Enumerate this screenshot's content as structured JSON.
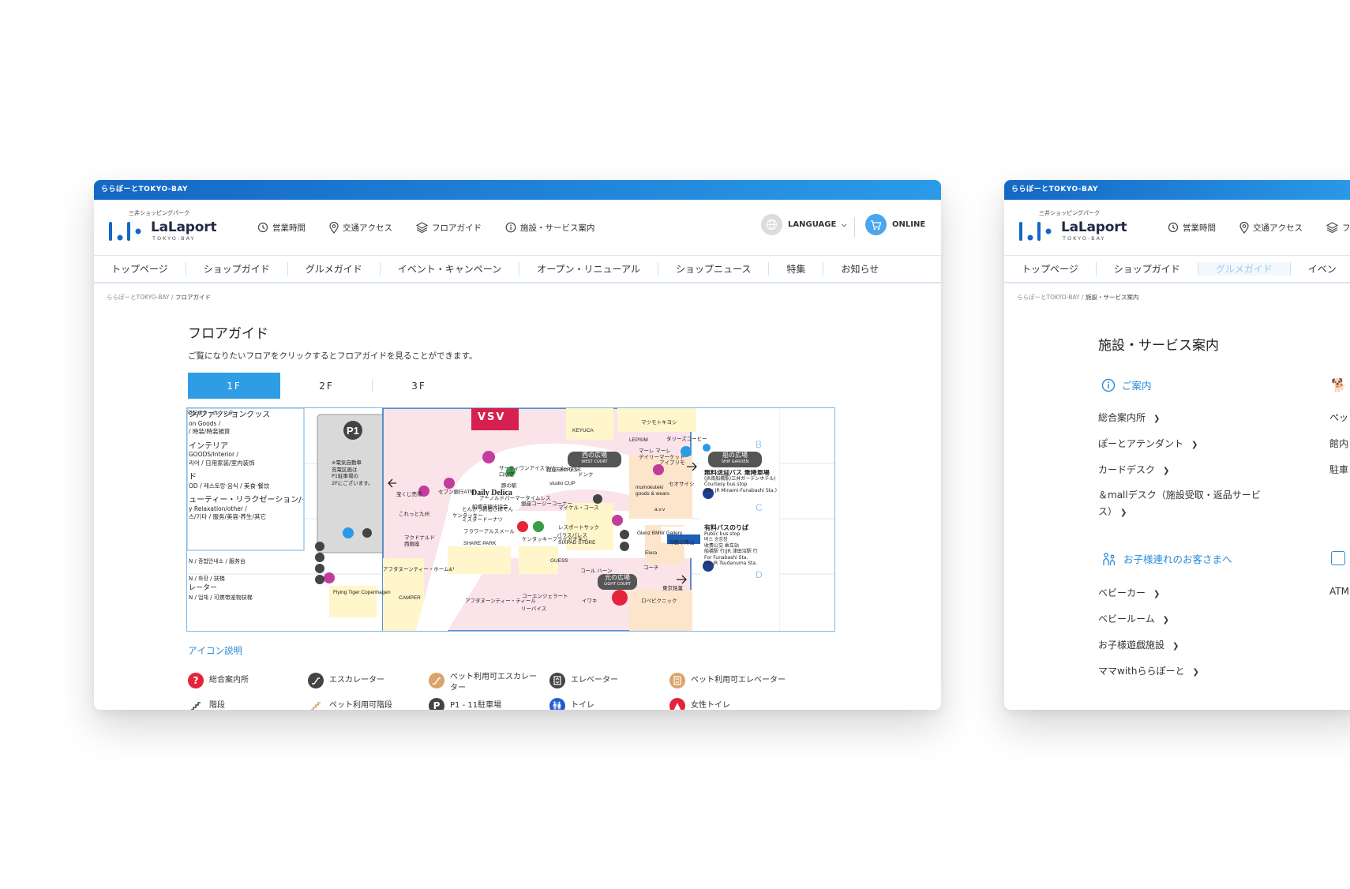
{
  "colors": {
    "brand_blue": "#1567c4",
    "accent_blue": "#2e9de6",
    "link_blue": "#2a8ad6",
    "map_pink": "#f6d8e0",
    "map_yellow": "#fff0c0",
    "map_grey": "#e8e8e8"
  },
  "window1": {
    "topbar": "ららぽーとTOKYO-BAY",
    "logo": {
      "sub": "三井ショッピングパーク",
      "name": "LaLaport",
      "bay": "TOKYO-BAY"
    },
    "header_nav": [
      {
        "label": "営業時間",
        "icon": "clock-icon"
      },
      {
        "label": "交通アクセス",
        "icon": "map-pin-icon"
      },
      {
        "label": "フロアガイド",
        "icon": "layers-icon"
      },
      {
        "label": "施設・サービス案内",
        "icon": "info-icon"
      }
    ],
    "language": "LANGUAGE",
    "online": "ONLINE",
    "global_nav": [
      "トップページ",
      "ショップガイド",
      "グルメガイド",
      "イベント・キャンペーン",
      "オープン・リニューアル",
      "ショップニュース",
      "特集",
      "お知らせ"
    ],
    "breadcrumb": {
      "home": "ららぽーとTOKYO-BAY",
      "sep": "/",
      "current": "フロアガイド"
    },
    "title": "フロアガイド",
    "description": "ご覧になりたいフロアをクリックするとフロアガイドを見ることができます。",
    "floor_tabs": [
      "1F",
      "2F",
      "3F"
    ],
    "active_floor": "1F",
    "map": {
      "left_legend": [
        "ン/ファッショングッズ",
        "on Goods /",
        "/ 時装/時装雑貨",
        "インテリア",
        "GOODS/Interior /",
        "리어 / 日用家装/室内装饰",
        "ド",
        "OD / 레스토랑·음식 / 美食·餐饮",
        "ューティー・リラクゼーション/その他",
        "y Relaxation/other /",
        "스/기타 / 服务/美容·养生/其它"
      ],
      "left_lower": [
        "N / 종합안내소 / 服务台",
        "N / 화장 / 扶梯",
        "レーター",
        "N / 업체 / 可携带宠物扶梯"
      ],
      "parking": {
        "label": "P1",
        "note1": "※電気自動車",
        "note2": "充電区画は",
        "note3": "P1駐車場の",
        "note4": "2Fにございます。"
      },
      "store_labels": [
        "マツモトキヨシ",
        "KEYUCA",
        "LEPSIM",
        "タリーズコーヒー",
        "マーレ マーレ",
        "デイリーマーケット",
        "アイブリモ",
        "Daily Delica",
        "セオサイシ",
        "mumokuteki",
        "goods & wears",
        "a.v.v",
        "マイケル・コース",
        "レスポートサック",
        "パラスパレス",
        "SIXPAD STORE",
        "ミスタードーナツ",
        "フラワーアルスメール",
        "SHARE PARK",
        "マクドナルド",
        "西銀座",
        "GUESS",
        "コーチ",
        "Elura",
        "コール ハーン",
        "イワキ",
        "アフタヌーンティー・ホーム&リビング",
        "アフタヌーンティー・ティールーム",
        "CAMPER",
        "Flying Tiger Copenhagen",
        "リーバイス",
        "ロペピクニック",
        "Glenz BMW Gallery",
        "洋服の青山",
        "宝くじ売場",
        "これっと九州",
        "セブン銀行ATM",
        "サーティワンアイスクリーム",
        "口福堂",
        "銀座コージーコーナー",
        "とんかつ新宿さぼてん",
        "ケンタッキーフライドチキン",
        "コーエンジェラート",
        "アーノルドパーマータイムレス",
        "豚の駅",
        "銀座EXPRESS",
        "ミニワン",
        "ドンク",
        "studio CUP",
        "船橋市観光協会",
        "ケンタッキー",
        "東京銘菓",
        "宅配承り・カウンター"
      ],
      "plaza_labels": [
        {
          "jp": "西の広場",
          "en": "WEST COURT"
        },
        {
          "jp": "船の広場",
          "en": "SHIP GARDEN"
        },
        {
          "jp": "光の広場",
          "en": "LIGHT COURT"
        }
      ],
      "bus_labels": [
        "無料送迎バス 乗降車場",
        "(JR南船橋駅/三井ガーデンホテル)",
        "Courtesy bus stop",
        "(For JR Minami-Funabashi Sta.)",
        "有料バスのりば",
        "Public bus stop",
        "버스 승강장",
        "收费公交 乘车站",
        "船橋駅 行/JR 津田沼駅 行",
        "For Funabashi Sta.",
        "For JR Tsudanuma Sta."
      ],
      "court_letters": [
        "B",
        "C",
        "D"
      ],
      "sign_text": "VSV"
    },
    "icon_explain": "アイコン説明",
    "legend": [
      {
        "icon": "info-desk-icon",
        "label": "総合案内所",
        "color": "#e5243b"
      },
      {
        "icon": "escalator-icon",
        "label": "エスカレーター",
        "color": "#444444"
      },
      {
        "icon": "pet-escalator-icon",
        "label": "ペット利用可エスカレーター",
        "color": "#d9a46a"
      },
      {
        "icon": "elevator-icon",
        "label": "エレベーター",
        "color": "#444444"
      },
      {
        "icon": "pet-elevator-icon",
        "label": "ペット利用可エレベーター",
        "color": "#d9a46a"
      }
    ],
    "legend_row2": [
      {
        "icon": "stairs-icon",
        "label": "階段",
        "color": "#444444"
      },
      {
        "icon": "pet-stairs-icon",
        "label": "ペット利用可階段",
        "color": "#d9a46a"
      },
      {
        "icon": "parking-icon",
        "label": "P1 - 11駐車場",
        "color": "#444444"
      },
      {
        "icon": "restroom-icon",
        "label": "トイレ",
        "color": "#2a5bd0"
      },
      {
        "icon": "women-restroom-icon",
        "label": "女性トイレ",
        "color": "#e5243b"
      }
    ]
  },
  "window2": {
    "topbar": "ららぽーとTOKYO-BAY",
    "logo": {
      "sub": "三井ショッピングパーク",
      "name": "LaLaport",
      "bay": "TOKYO-BAY"
    },
    "header_nav": [
      {
        "label": "営業時間",
        "icon": "clock-icon"
      },
      {
        "label": "交通アクセス",
        "icon": "map-pin-icon"
      },
      {
        "label": "フ",
        "icon": "layers-icon"
      }
    ],
    "global_nav": [
      "トップページ",
      "ショップガイド",
      "グルメガイド",
      "イベン"
    ],
    "breadcrumb": {
      "home": "ららぽーとTOKYO-BAY",
      "sep": "/",
      "current": "施設・サービス案内"
    },
    "title": "施設・サービス案内",
    "sections": [
      {
        "icon": "info-icon",
        "label": "ご案内",
        "items": [
          "総合案内所",
          "ぽーとアテンダント",
          "カードデスク",
          "＆mallデスク（施設受取・返品サービ",
          "ス）"
        ]
      },
      {
        "icon": "kids-icon",
        "label": "お子様連れのお客さまへ",
        "items": [
          "ベビーカー",
          "ベビールーム",
          "お子様遊戯施設",
          "ママwithららぽーと"
        ]
      }
    ],
    "right_column": [
      "ペッ",
      "館内",
      "駐車",
      "ATM"
    ]
  }
}
